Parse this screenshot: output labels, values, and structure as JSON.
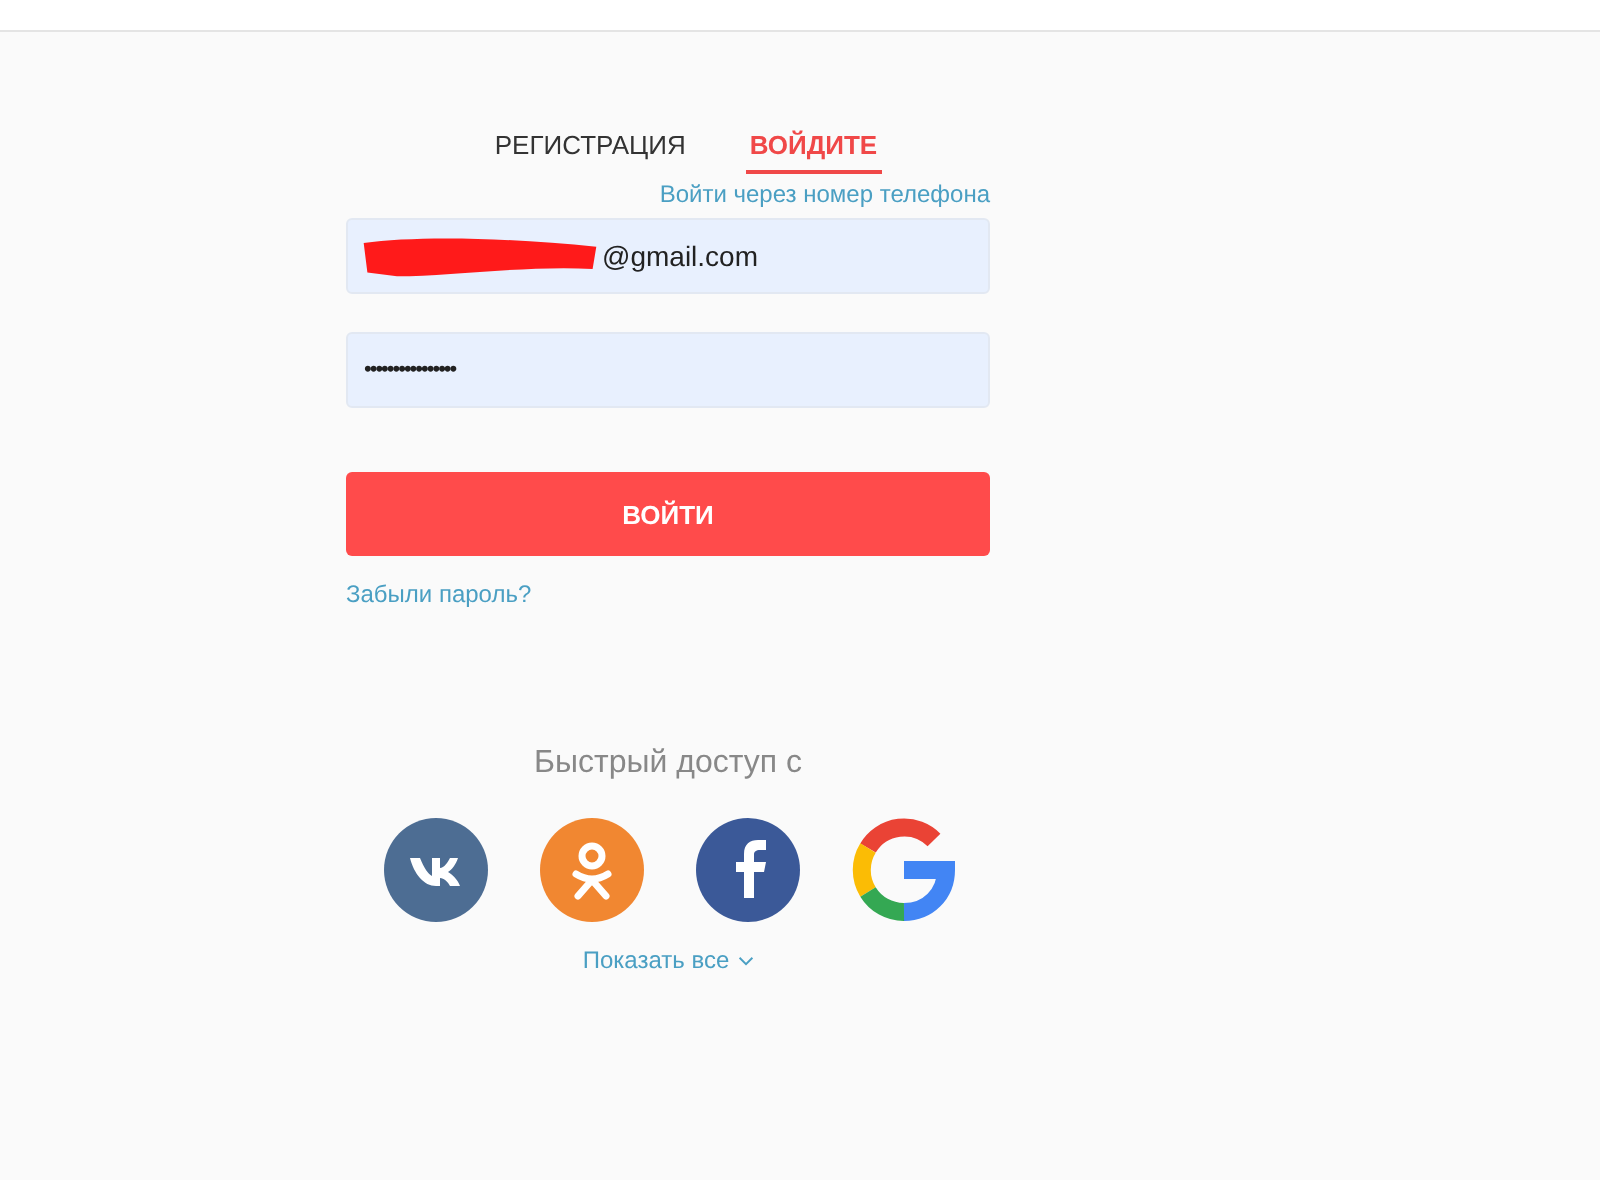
{
  "tabs": [
    {
      "label": "РЕГИСТРАЦИЯ",
      "selected": false
    },
    {
      "label": "ВОЙДИТЕ",
      "selected": true
    }
  ],
  "phone_login_link": "Войти через номер телефона",
  "email_field": {
    "value": "@gmail.com",
    "redacted": true
  },
  "password_field": {
    "value": "••••••••••••••••"
  },
  "submit_button": "ВОЙТИ",
  "forgot_link": "Забыли пароль?",
  "quick_access_title": "Быстрый доступ с",
  "social": [
    {
      "kind": "vk"
    },
    {
      "kind": "ok"
    },
    {
      "kind": "facebook"
    },
    {
      "kind": "google"
    }
  ],
  "show_all_link": "Показать все"
}
